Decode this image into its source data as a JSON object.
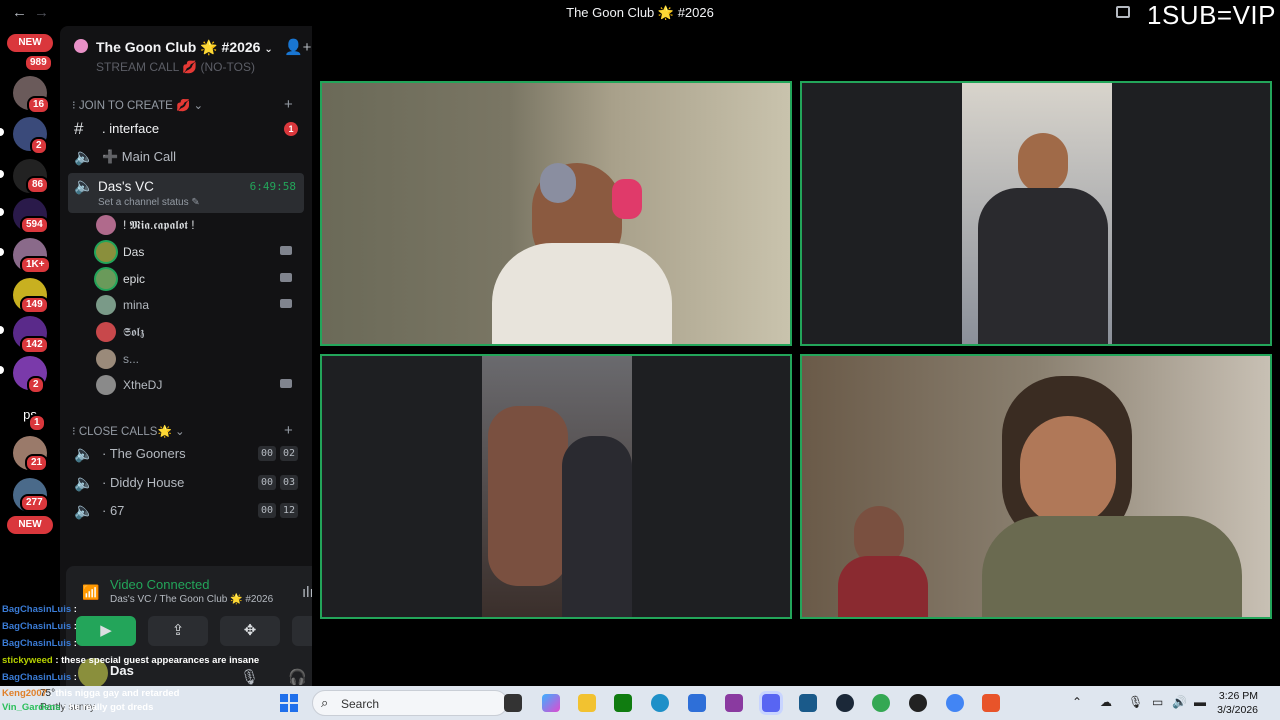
{
  "window": {
    "title": "The Goon Club 🌟 #2026",
    "back": "←",
    "forward": "→",
    "overlay_text": "1SUB=VIP"
  },
  "guild_bar": {
    "new_label": "NEW",
    "badges": [
      "989",
      "16",
      "2",
      "86",
      "594",
      "1K+",
      "149",
      "142",
      "2",
      "1",
      "21",
      "277"
    ],
    "ps_label": "ps"
  },
  "server": {
    "name": "The Goon Club 🌟 #2026",
    "cut_channel": "STREAM CALL 💋 (NO-TOS)",
    "categories": {
      "join_to_create": "JOIN TO CREATE 💋",
      "close_calls": "CLOSE CALLS🌟"
    },
    "channels": [
      {
        "name": ". interface",
        "unread": "1"
      },
      {
        "name": "➕ Main Call"
      },
      {
        "name": "Das's VC",
        "time": "6:49:58",
        "status": "Set a channel status"
      }
    ],
    "voice_users": [
      {
        "name": "! 𝕸𝖎𝖆.𝖈𝖆𝖕𝖆𝖑𝖔𝖙 !",
        "color": "#b06a8c"
      },
      {
        "name": "Das",
        "color": "#8a8f3c"
      },
      {
        "name": "epic",
        "color": "#6a9a5a"
      },
      {
        "name": "mina",
        "color": "#7a9a88"
      },
      {
        "name": "𝕾𝖔𝖑𝖟",
        "color": "#c8484b"
      },
      {
        "name": "s...",
        "color": "#9a8a7a"
      },
      {
        "name": "XtheDJ",
        "color": "#8a8a8a"
      }
    ],
    "close_calls": [
      {
        "name": "The Gooners",
        "a": "00",
        "b": "02"
      },
      {
        "name": "Diddy House",
        "a": "00",
        "b": "03"
      },
      {
        "name": "67",
        "a": "00",
        "b": "12"
      }
    ]
  },
  "voice_panel": {
    "title": "Video Connected",
    "subtitle": "Das's VC / The Goon Club 🌟 #2026",
    "username": "Das"
  },
  "chat_overlay": [
    {
      "user": "BagChasinLuis",
      "text": " :",
      "color": "#3a7bd5"
    },
    {
      "user": "BagChasinLuis",
      "text": " :",
      "color": "#3a7bd5"
    },
    {
      "user": "BagChasinLuis",
      "text": " :",
      "color": "#3a7bd5"
    },
    {
      "user": "stickyweed",
      "text": " : these special guest appearances are insane",
      "color": "#b6d000"
    },
    {
      "user": "BagChasinLuis",
      "text": " :",
      "color": "#3a7bd5"
    },
    {
      "user": "Keng2007",
      "text": " : this nigga gay and retarded",
      "color": "#e0802a"
    },
    {
      "user": "Vin_Gardens",
      "text": " : he really got dreds",
      "color": "#2bbf5a"
    }
  ],
  "weather": {
    "temp": "75°",
    "desc": "Partly sunny"
  },
  "taskbar": {
    "search_label": "Search",
    "time": "3:26 PM",
    "date": "3/3/2026"
  },
  "colors": {
    "connected_green": "#23a55a",
    "danger_red": "#da373c",
    "panel_bg": "#121214"
  }
}
